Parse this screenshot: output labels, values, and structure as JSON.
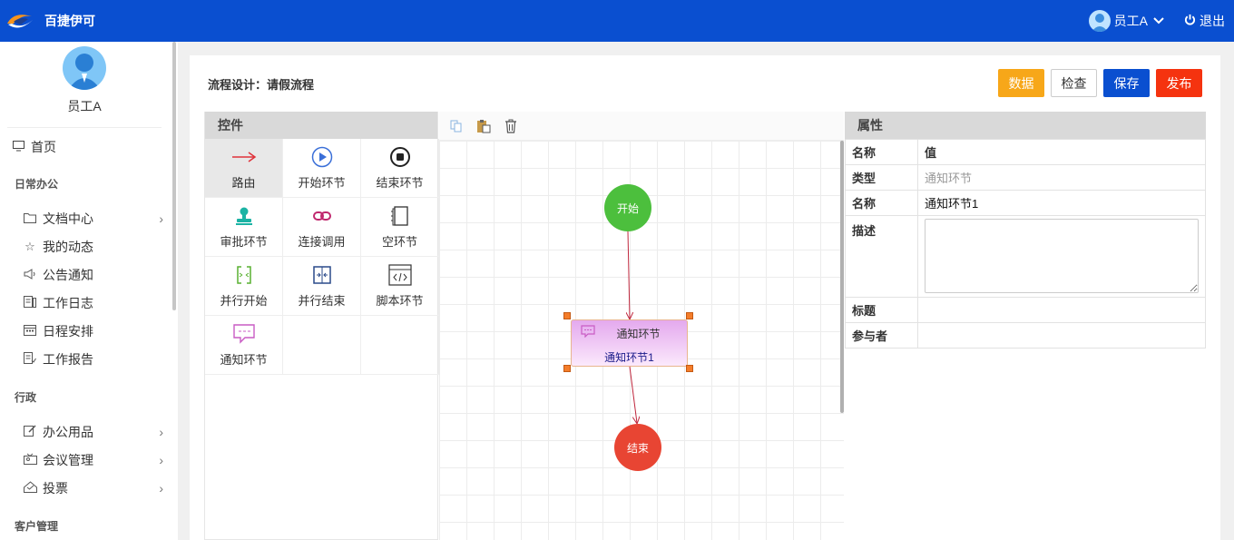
{
  "app": {
    "title": "百捷伊可"
  },
  "topbar": {
    "user_name": "员工A",
    "logout_label": "退出"
  },
  "profile": {
    "name": "员工A"
  },
  "nav": {
    "home": "首页",
    "group_daily": "日常办公",
    "doc_center": "文档中心",
    "my_activity": "我的动态",
    "announcements": "公告通知",
    "work_log": "工作日志",
    "schedule": "日程安排",
    "work_report": "工作报告",
    "group_admin": "行政",
    "office_supplies": "办公用品",
    "meeting_mgmt": "会议管理",
    "voting": "投票",
    "group_customer": "客户管理"
  },
  "header": {
    "title": "流程设计：请假流程",
    "buttons": {
      "data": "数据",
      "check": "检查",
      "save": "保存",
      "publish": "发布"
    }
  },
  "palette": {
    "title": "控件",
    "items": [
      {
        "label": "路由",
        "icon": "route-arrow-icon"
      },
      {
        "label": "开始环节",
        "icon": "play-circle-icon"
      },
      {
        "label": "结束环节",
        "icon": "stop-circle-icon"
      },
      {
        "label": "审批环节",
        "icon": "stamp-icon"
      },
      {
        "label": "连接调用",
        "icon": "link-icon"
      },
      {
        "label": "空环节",
        "icon": "blank-page-icon"
      },
      {
        "label": "并行开始",
        "icon": "parallel-start-icon"
      },
      {
        "label": "并行结束",
        "icon": "parallel-end-icon"
      },
      {
        "label": "脚本环节",
        "icon": "code-icon"
      },
      {
        "label": "通知环节",
        "icon": "message-icon"
      }
    ]
  },
  "canvas": {
    "toolbar": [
      "copy-icon",
      "paste-icon",
      "delete-icon"
    ],
    "nodes": {
      "start": "开始",
      "task_type": "通知环节",
      "task_name": "通知环节1",
      "end": "结束"
    },
    "colors": {
      "start": "#4cbf3d",
      "end": "#e84533",
      "edge": "#c0283e"
    }
  },
  "properties": {
    "title": "属性",
    "header_key": "名称",
    "header_value": "值",
    "rows": {
      "type_key": "类型",
      "type_value": "通知环节",
      "name_key": "名称",
      "name_value": "通知环节1",
      "desc_key": "描述",
      "desc_value": "",
      "title_key": "标题",
      "title_value": "",
      "participants_key": "参与者",
      "participants_value": ""
    }
  }
}
